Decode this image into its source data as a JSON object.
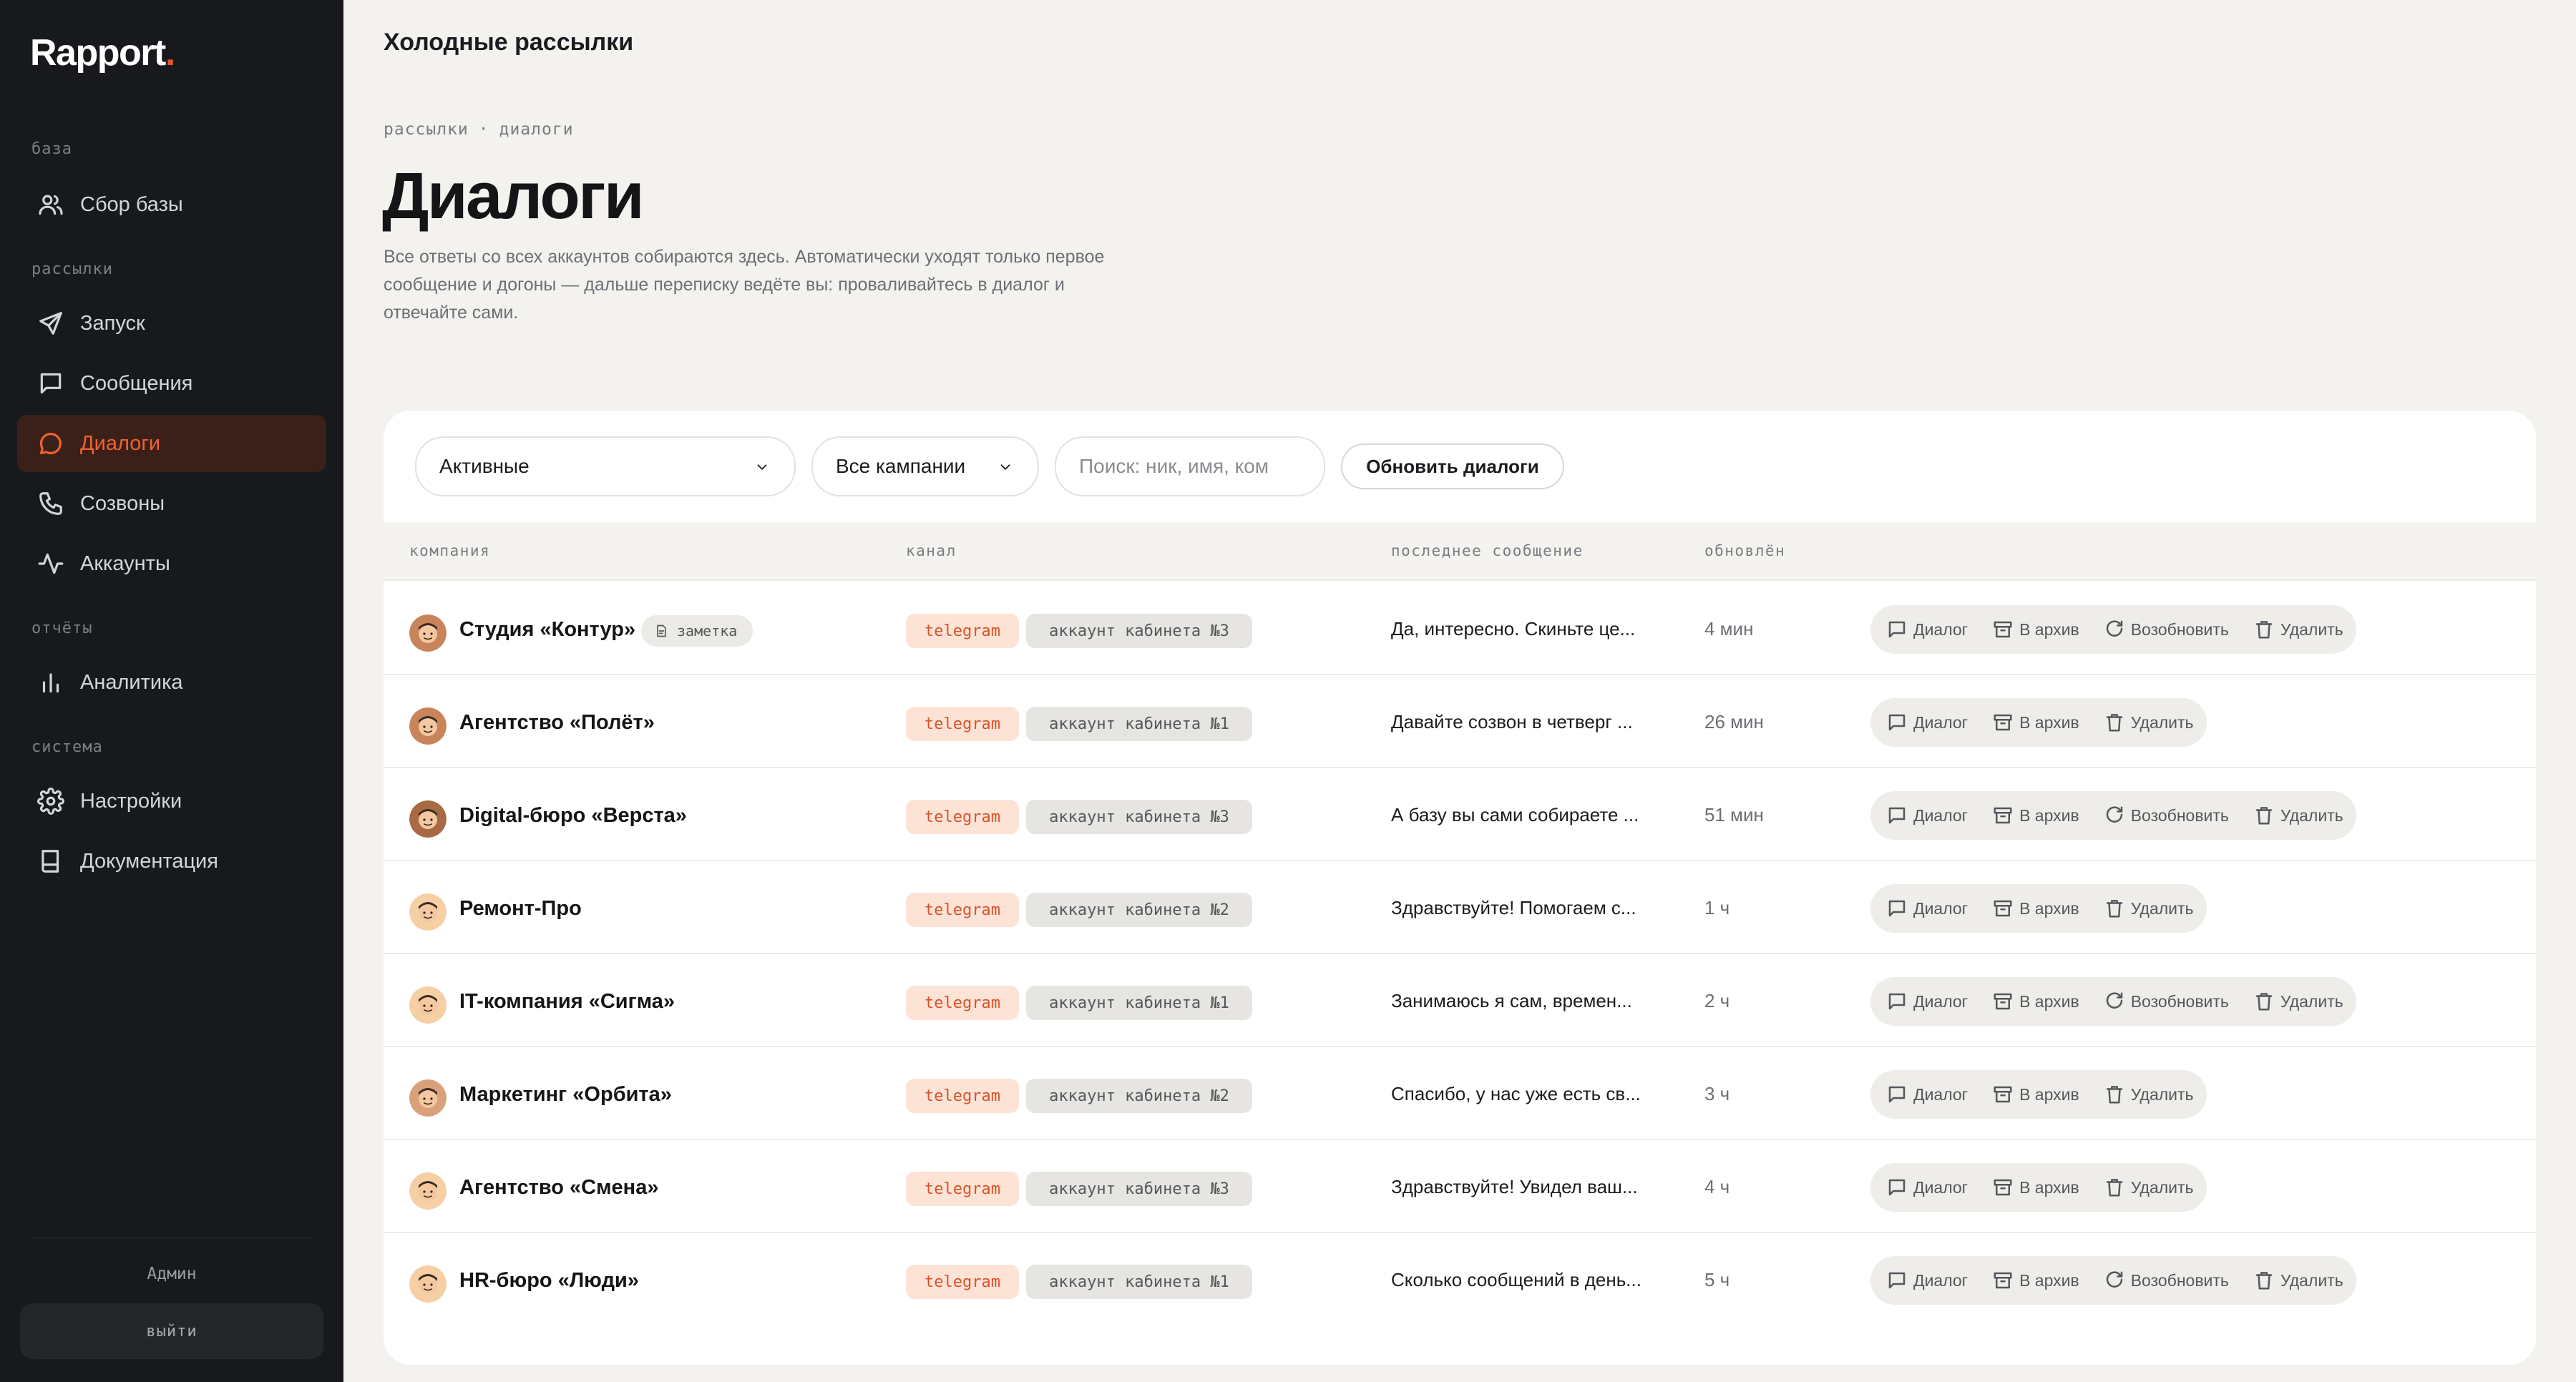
{
  "app": {
    "logo": "Rapport",
    "logo_dot": "."
  },
  "sidebar": {
    "sections": [
      {
        "label": "база"
      },
      {
        "label": "рассылки"
      },
      {
        "label": "отчёты"
      },
      {
        "label": "система"
      }
    ],
    "items": [
      {
        "label": "Сбор базы",
        "icon": "users-icon"
      },
      {
        "label": "Запуск",
        "icon": "send-icon"
      },
      {
        "label": "Сообщения",
        "icon": "message-icon"
      },
      {
        "label": "Диалоги",
        "icon": "chat-icon",
        "active": true
      },
      {
        "label": "Созвоны",
        "icon": "phone-icon"
      },
      {
        "label": "Аккаунты",
        "icon": "activity-icon"
      },
      {
        "label": "Аналитика",
        "icon": "bar-chart-icon"
      },
      {
        "label": "Настройки",
        "icon": "gear-icon"
      },
      {
        "label": "Документация",
        "icon": "book-icon"
      }
    ],
    "user": "Админ",
    "logout": "выйти"
  },
  "header": {
    "title": "Холодные рассылки"
  },
  "breadcrumb": {
    "items": [
      "рассылки",
      "диалоги"
    ],
    "separator": "·"
  },
  "page": {
    "title": "Диалоги",
    "description": "Все ответы со всех аккаунтов собираются здесь. Автоматически уходят только первое сообщение и догоны — дальше переписку ведёте вы: проваливайтесь в диалог и отвечайте сами."
  },
  "filters": {
    "status": "Активные",
    "campaign": "Все кампании",
    "search_placeholder": "Поиск: ник, имя, ком",
    "refresh": "Обновить диалоги"
  },
  "table": {
    "columns": [
      "компания",
      "канал",
      "последнее сообщение",
      "обновлён"
    ],
    "action_labels": {
      "dialog": "Диалог",
      "archive": "В архив",
      "resume": "Возобновить",
      "delete": "Удалить"
    },
    "rows": [
      {
        "company": "Студия «Контур»",
        "note": "заметка",
        "channel": "telegram",
        "account": "аккаунт кабинета №3",
        "last_message": "Да, интересно. Скиньте це...",
        "updated": "4 мин",
        "resume": true,
        "avatar_color": "#c8845a"
      },
      {
        "company": "Агентство «Полёт»",
        "channel": "telegram",
        "account": "аккаунт кабинета №1",
        "last_message": "Давайте созвон в четверг ...",
        "updated": "26 мин",
        "resume": false,
        "avatar_color": "#c8845a"
      },
      {
        "company": "Digital-бюро «Верста»",
        "channel": "telegram",
        "account": "аккаунт кабинета №3",
        "last_message": "А базу вы сами собираете ...",
        "updated": "51 мин",
        "resume": true,
        "avatar_color": "#a86a45"
      },
      {
        "company": "Ремонт-Про",
        "channel": "telegram",
        "account": "аккаунт кабинета №2",
        "last_message": "Здравствуйте! Помогаем с...",
        "updated": "1 ч",
        "resume": false,
        "avatar_color": "#f6cfa4"
      },
      {
        "company": "IT-компания «Сигма»",
        "channel": "telegram",
        "account": "аккаунт кабинета №1",
        "last_message": "Занимаюсь я сам, времен...",
        "updated": "2 ч",
        "resume": true,
        "avatar_color": "#f6cfa4"
      },
      {
        "company": "Маркетинг «Орбита»",
        "channel": "telegram",
        "account": "аккаунт кабинета №2",
        "last_message": "Спасибо, у нас уже есть св...",
        "updated": "3 ч",
        "resume": false,
        "avatar_color": "#d9a17a"
      },
      {
        "company": "Агентство «Смена»",
        "channel": "telegram",
        "account": "аккаунт кабинета №3",
        "last_message": "Здравствуйте! Увидел ваш...",
        "updated": "4 ч",
        "resume": false,
        "avatar_color": "#f6cfa4"
      },
      {
        "company": "HR-бюро «Люди»",
        "channel": "telegram",
        "account": "аккаунт кабинета №1",
        "last_message": "Сколько сообщений в день...",
        "updated": "5 ч",
        "resume": true,
        "avatar_color": "#f6cfa4"
      }
    ]
  },
  "colors": {
    "accent": "#e8542a",
    "sidebar_bg": "#17191c",
    "page_bg": "#f3f2ef"
  }
}
